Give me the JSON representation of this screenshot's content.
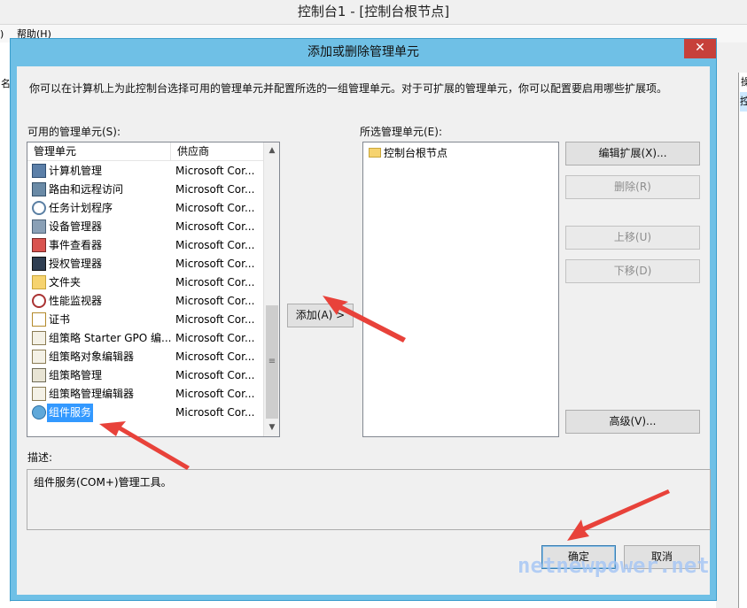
{
  "window": {
    "title": "控制台1 - [控制台根节点]",
    "menu_paren": ")",
    "menu_help": "帮助(H)",
    "left_fragment": "名",
    "right_fragment": "操",
    "right_selected_fragment": "控"
  },
  "dialog": {
    "title": "添加或删除管理单元",
    "close_glyph": "✕",
    "intro": "你可以在计算机上为此控制台选择可用的管理单元并配置所选的一组管理单元。对于可扩展的管理单元，你可以配置要启用哪些扩展项。",
    "available_label": "可用的管理单元(S):",
    "selected_label": "所选管理单元(E):",
    "columns": {
      "name": "管理单元",
      "vendor": "供应商"
    },
    "snapins": [
      {
        "name": "计算机管理",
        "vendor": "Microsoft Cor...",
        "icon": "computer-management-icon"
      },
      {
        "name": "路由和远程访问",
        "vendor": "Microsoft Cor...",
        "icon": "routing-icon"
      },
      {
        "name": "任务计划程序",
        "vendor": "Microsoft Cor...",
        "icon": "clock-icon"
      },
      {
        "name": "设备管理器",
        "vendor": "Microsoft Cor...",
        "icon": "device-manager-icon"
      },
      {
        "name": "事件查看器",
        "vendor": "Microsoft Cor...",
        "icon": "event-viewer-icon"
      },
      {
        "name": "授权管理器",
        "vendor": "Microsoft Cor...",
        "icon": "authorization-icon"
      },
      {
        "name": "文件夹",
        "vendor": "Microsoft Cor...",
        "icon": "folder-icon"
      },
      {
        "name": "性能监视器",
        "vendor": "Microsoft Cor...",
        "icon": "performance-icon"
      },
      {
        "name": "证书",
        "vendor": "Microsoft Cor...",
        "icon": "certificate-icon"
      },
      {
        "name": "组策略 Starter GPO 编...",
        "vendor": "Microsoft Cor...",
        "icon": "policy-icon"
      },
      {
        "name": "组策略对象编辑器",
        "vendor": "Microsoft Cor...",
        "icon": "policy-icon"
      },
      {
        "name": "组策略管理",
        "vendor": "Microsoft Cor...",
        "icon": "policy-management-icon"
      },
      {
        "name": "组策略管理编辑器",
        "vendor": "Microsoft Cor...",
        "icon": "policy-icon"
      },
      {
        "name": "组件服务",
        "vendor": "Microsoft Cor...",
        "icon": "component-services-icon",
        "selected": true
      }
    ],
    "add_button": "添加(A) >",
    "selected_items": [
      "控制台根节点"
    ],
    "buttons": {
      "edit_extensions": "编辑扩展(X)...",
      "remove": "删除(R)",
      "move_up": "上移(U)",
      "move_down": "下移(D)",
      "advanced": "高级(V)...",
      "ok": "确定",
      "cancel": "取消"
    },
    "description_label": "描述:",
    "description": "组件服务(COM+)管理工具。"
  },
  "watermark": "netnewpower.net",
  "colors": {
    "dialog_frame": "#6fc0e6",
    "close_button": "#c7403a",
    "selection": "#3399ff",
    "annotation_arrow": "#e8423a"
  }
}
